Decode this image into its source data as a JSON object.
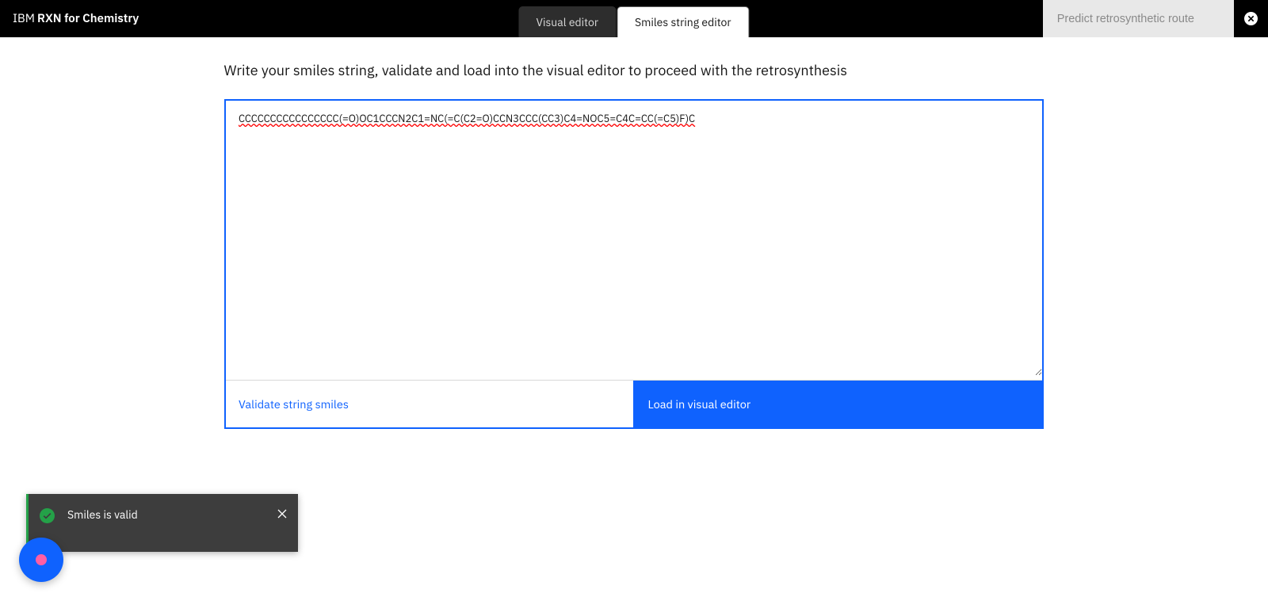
{
  "header": {
    "logo_ibm": "IBM",
    "logo_rxn": "RXN for Chemistry",
    "tabs": {
      "visual_editor": "Visual editor",
      "smiles_editor": "Smiles string editor"
    },
    "predict_label": "Predict retrosynthetic route"
  },
  "main": {
    "instruction": "Write your smiles string, validate and load into the visual editor to proceed with the retrosynthesis",
    "smiles_value": "CCCCCCCCCCCCCCCC(=O)OC1CCCN2C1=NC(=C(C2=O)CCN3CCC(CC3)C4=NOC5=C4C=CC(=C5)F)C",
    "validate_label": "Validate string smiles",
    "load_label": "Load in visual editor"
  },
  "toast": {
    "message": "Smiles is valid"
  }
}
